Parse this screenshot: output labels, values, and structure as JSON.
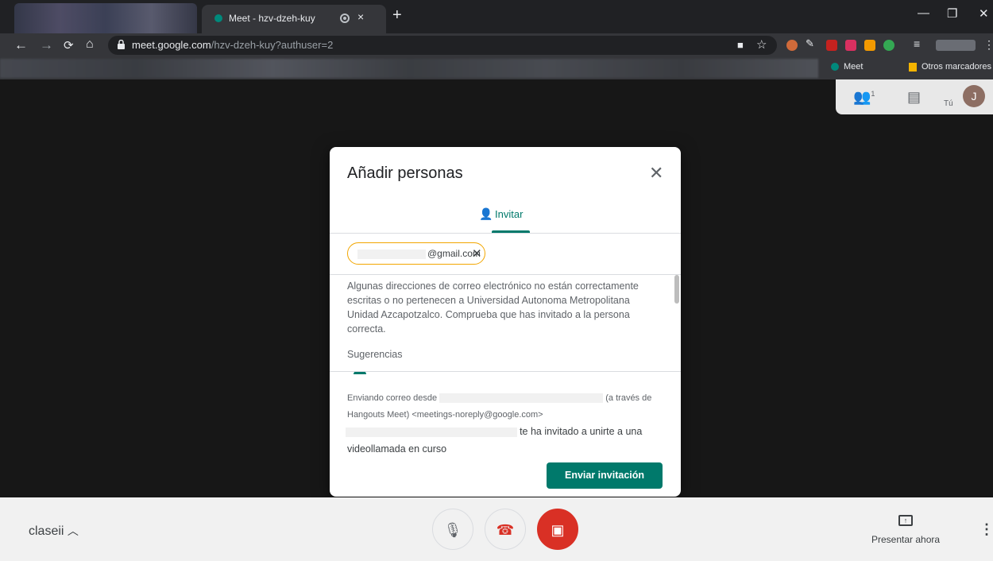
{
  "browser": {
    "tab_title": "Meet - hzv-dzeh-kuy",
    "tab_close": "×",
    "new_tab": "+",
    "url_host": "meet.google.com",
    "url_path": "/hzv-dzeh-kuy?authuser=2",
    "bookmarks": [
      {
        "label": "Meet",
        "icon": "meet-icon"
      },
      {
        "label": "Otros marcadores",
        "icon": "folder-icon"
      }
    ],
    "window_controls": [
      "—",
      "❐",
      "✕"
    ]
  },
  "side_panel": {
    "people_count": "1",
    "you_label": "Tú",
    "avatar_letter": "J"
  },
  "dialog": {
    "title": "Añadir personas",
    "tab_label": "Invitar",
    "chip_email": "@gmail.com",
    "warning": "Algunas direcciones de correo electrónico no están correctamente escritas o no pertenecen a Universidad Autonoma Metropolitana Unidad Azcapotzalco. Comprueba que has invitado a la persona correcta.",
    "suggestions_label": "Sugerencias",
    "footer_prefix": "Enviando correo desde",
    "footer_via": "(a través de Hangouts Meet) <meetings-noreply@google.com>",
    "footer_invited": "te ha invitado a unirte a una",
    "footer_end": "videollamada en curso",
    "send_button": "Enviar invitación",
    "colors": {
      "accent": "#00796b",
      "chip_border": "#f2a600"
    }
  },
  "bottom_bar": {
    "meeting_name": "claseii",
    "present_label": "Presentar ahora",
    "end_call_color": "#d93025"
  }
}
